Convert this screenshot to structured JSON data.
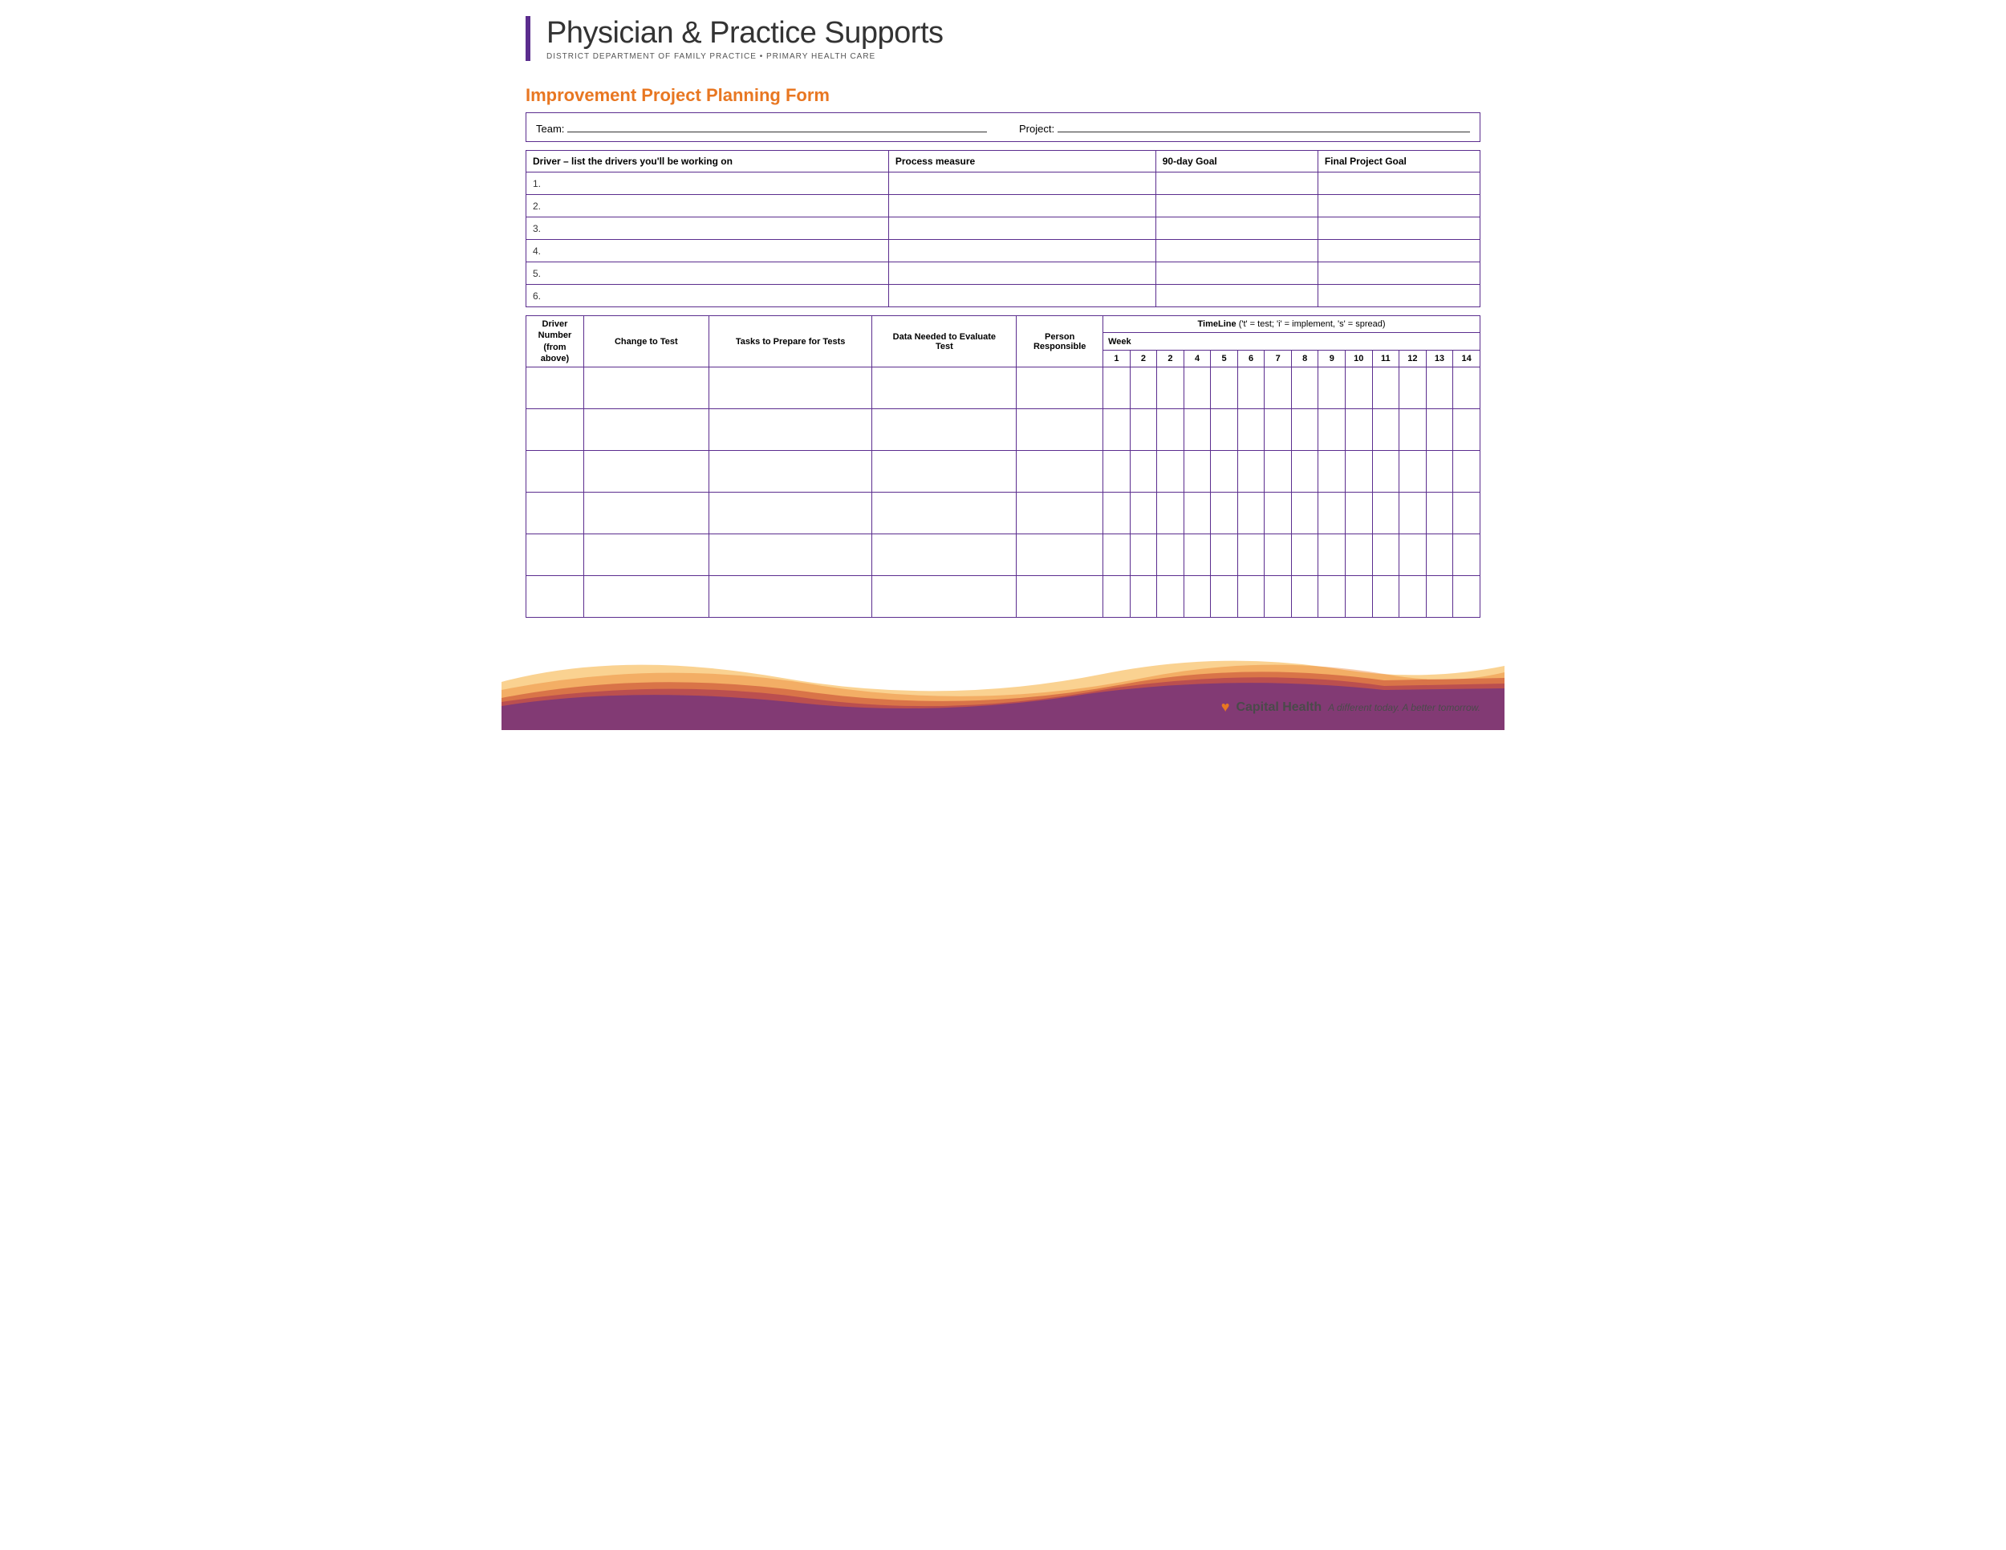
{
  "header": {
    "bar_color": "#5b2d8e",
    "title": "Physician & Practice Supports",
    "subtitle": "DISTRICT DEPARTMENT OF FAMILY PRACTICE  •  PRIMARY HEALTH CARE"
  },
  "form": {
    "title": "Improvement Project Planning Form",
    "team_label": "Team:",
    "project_label": "Project:"
  },
  "driver_table": {
    "columns": [
      "Driver – list the drivers you'll be working on",
      "Process measure",
      "90-day Goal",
      "Final Project Goal"
    ],
    "rows": [
      {
        "num": "1."
      },
      {
        "num": "2."
      },
      {
        "num": "3."
      },
      {
        "num": "4."
      },
      {
        "num": "5."
      },
      {
        "num": "6."
      }
    ]
  },
  "timeline_table": {
    "header_label": "TimeLine",
    "header_note": "('t' = test; 'i' = implement, 's' = spread)",
    "col_driver": "Driver Number (from above)",
    "col_change": "Change to Test",
    "col_tasks": "Tasks to Prepare for Tests",
    "col_data": "Data Needed to Evaluate Test",
    "col_person": "Person Responsible",
    "week_label": "Week",
    "weeks": [
      "1",
      "2",
      "2",
      "4",
      "5",
      "6",
      "7",
      "8",
      "9",
      "10",
      "11",
      "12",
      "13",
      "14"
    ],
    "num_data_rows": 6
  },
  "footer": {
    "capital_health": "Capital Health",
    "tagline": "A different today. A better tomorrow."
  }
}
